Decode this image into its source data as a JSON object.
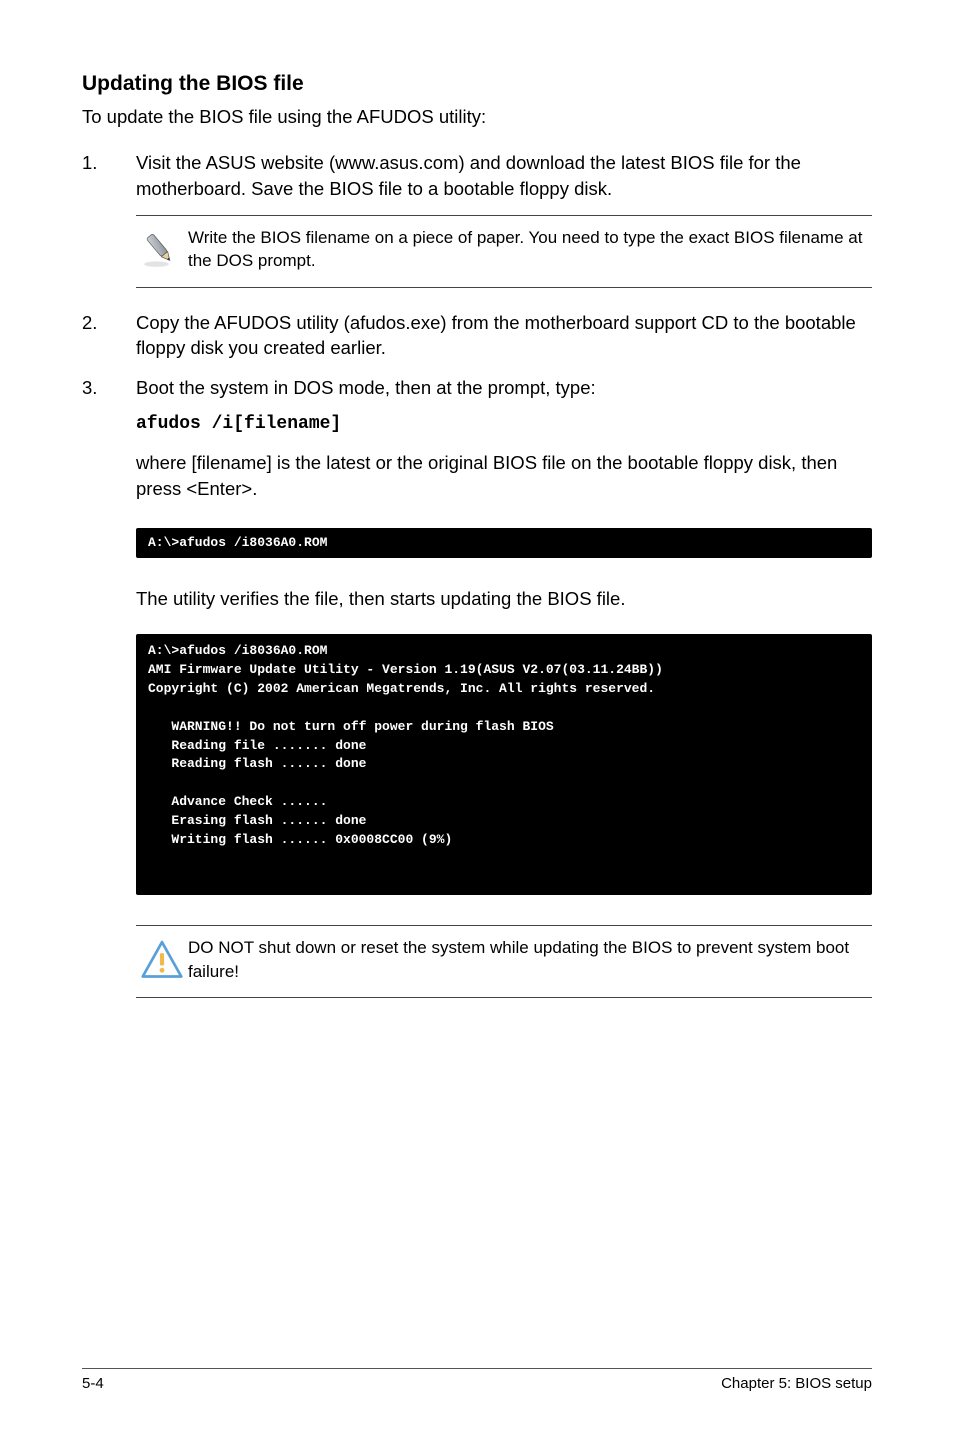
{
  "heading": "Updating the BIOS file",
  "intro": "To update the BIOS file using the AFUDOS utility:",
  "steps": {
    "s1": {
      "num": "1.",
      "text": "Visit the ASUS website (www.asus.com) and download the latest BIOS file for the motherboard. Save the BIOS file to a bootable floppy disk."
    },
    "note1": "Write the BIOS filename on a piece of paper. You need to type the exact BIOS filename at the DOS prompt.",
    "s2": {
      "num": "2.",
      "text": "Copy the AFUDOS utility (afudos.exe) from the motherboard support CD to the bootable floppy disk you created earlier."
    },
    "s3": {
      "num": "3.",
      "text": "Boot the system in DOS mode, then at the prompt, type:"
    },
    "cmd": "afudos /i[filename]",
    "where": "where [filename] is the latest or the original BIOS file on the bootable floppy disk, then press <Enter>."
  },
  "terminal1": "A:\\>afudos /i8036A0.ROM",
  "verify": "The utility verifies the file, then starts updating the BIOS file.",
  "terminal2": "A:\\>afudos /i8036A0.ROM\nAMI Firmware Update Utility - Version 1.19(ASUS V2.07(03.11.24BB))\nCopyright (C) 2002 American Megatrends, Inc. All rights reserved.\n\n   WARNING!! Do not turn off power during flash BIOS\n   Reading file ....... done\n   Reading flash ...... done\n\n   Advance Check ......\n   Erasing flash ...... done\n   Writing flash ...... 0x0008CC00 (9%)\n\n\n",
  "warn_note": "DO NOT shut down or reset the system while updating the BIOS to prevent system boot failure!",
  "footer": {
    "left": "5-4",
    "right": "Chapter 5: BIOS setup"
  }
}
